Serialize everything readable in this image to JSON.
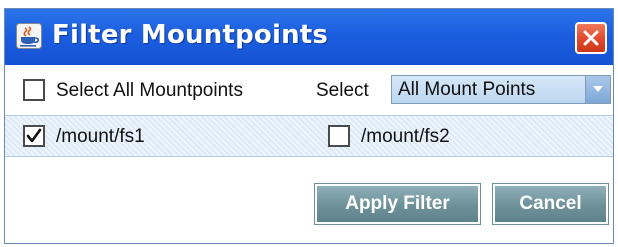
{
  "window": {
    "title": "Filter Mountpoints",
    "icon": "java-cup-icon",
    "close_icon": "close-icon"
  },
  "select_row": {
    "select_all_label": "Select All Mountpoints",
    "select_all_checked": false,
    "select_label": "Select",
    "select_value": "All Mount Points"
  },
  "mountpoints": [
    {
      "label": "/mount/fs1",
      "checked": true
    },
    {
      "label": "/mount/fs2",
      "checked": false
    }
  ],
  "buttons": {
    "apply": "Apply Filter",
    "cancel": "Cancel"
  },
  "colors": {
    "titlebar": "#1c5ee0",
    "close": "#e0482c",
    "button": "#6e9199",
    "mount_row": "#dceaf7"
  }
}
